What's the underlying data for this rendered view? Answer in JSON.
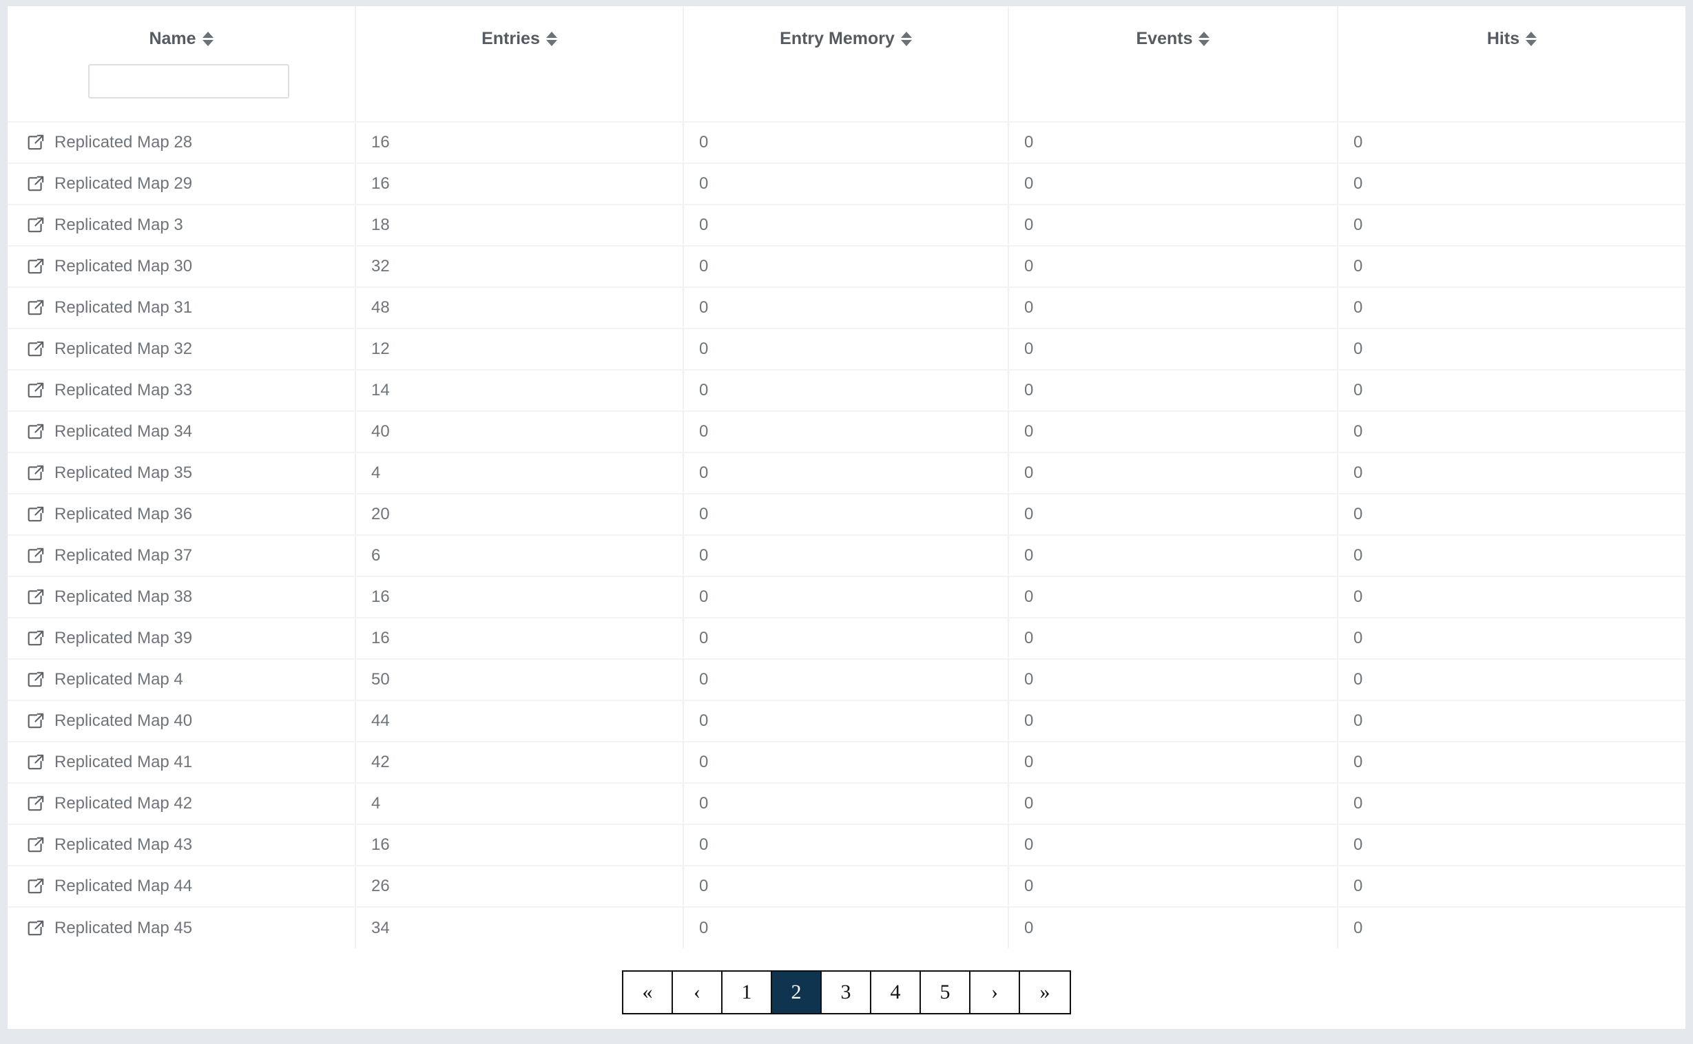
{
  "table": {
    "columns": [
      {
        "label": "Name",
        "sort_icon": "sort-both-icon",
        "key": "name"
      },
      {
        "label": "Entries",
        "sort_icon": "sort-both-icon",
        "key": "entries"
      },
      {
        "label": "Entry Memory",
        "sort_icon": "sort-both-icon",
        "key": "entry_memory"
      },
      {
        "label": "Events",
        "sort_icon": "sort-both-icon",
        "key": "events"
      },
      {
        "label": "Hits",
        "sort_icon": "sort-both-icon",
        "key": "hits"
      }
    ],
    "filter": {
      "value": "",
      "placeholder": ""
    },
    "row_icon": "external-link-icon",
    "rows": [
      {
        "name": "Replicated Map 28",
        "entries": "16",
        "entry_memory": "0",
        "events": "0",
        "hits": "0"
      },
      {
        "name": "Replicated Map 29",
        "entries": "16",
        "entry_memory": "0",
        "events": "0",
        "hits": "0"
      },
      {
        "name": "Replicated Map 3",
        "entries": "18",
        "entry_memory": "0",
        "events": "0",
        "hits": "0"
      },
      {
        "name": "Replicated Map 30",
        "entries": "32",
        "entry_memory": "0",
        "events": "0",
        "hits": "0"
      },
      {
        "name": "Replicated Map 31",
        "entries": "48",
        "entry_memory": "0",
        "events": "0",
        "hits": "0"
      },
      {
        "name": "Replicated Map 32",
        "entries": "12",
        "entry_memory": "0",
        "events": "0",
        "hits": "0"
      },
      {
        "name": "Replicated Map 33",
        "entries": "14",
        "entry_memory": "0",
        "events": "0",
        "hits": "0"
      },
      {
        "name": "Replicated Map 34",
        "entries": "40",
        "entry_memory": "0",
        "events": "0",
        "hits": "0"
      },
      {
        "name": "Replicated Map 35",
        "entries": "4",
        "entry_memory": "0",
        "events": "0",
        "hits": "0"
      },
      {
        "name": "Replicated Map 36",
        "entries": "20",
        "entry_memory": "0",
        "events": "0",
        "hits": "0"
      },
      {
        "name": "Replicated Map 37",
        "entries": "6",
        "entry_memory": "0",
        "events": "0",
        "hits": "0"
      },
      {
        "name": "Replicated Map 38",
        "entries": "16",
        "entry_memory": "0",
        "events": "0",
        "hits": "0"
      },
      {
        "name": "Replicated Map 39",
        "entries": "16",
        "entry_memory": "0",
        "events": "0",
        "hits": "0"
      },
      {
        "name": "Replicated Map 4",
        "entries": "50",
        "entry_memory": "0",
        "events": "0",
        "hits": "0"
      },
      {
        "name": "Replicated Map 40",
        "entries": "44",
        "entry_memory": "0",
        "events": "0",
        "hits": "0"
      },
      {
        "name": "Replicated Map 41",
        "entries": "42",
        "entry_memory": "0",
        "events": "0",
        "hits": "0"
      },
      {
        "name": "Replicated Map 42",
        "entries": "4",
        "entry_memory": "0",
        "events": "0",
        "hits": "0"
      },
      {
        "name": "Replicated Map 43",
        "entries": "16",
        "entry_memory": "0",
        "events": "0",
        "hits": "0"
      },
      {
        "name": "Replicated Map 44",
        "entries": "26",
        "entry_memory": "0",
        "events": "0",
        "hits": "0"
      },
      {
        "name": "Replicated Map 45",
        "entries": "34",
        "entry_memory": "0",
        "events": "0",
        "hits": "0"
      }
    ]
  },
  "pagination": {
    "items": [
      {
        "label": "«",
        "name": "first-page-button",
        "active": false
      },
      {
        "label": "‹",
        "name": "previous-page-button",
        "active": false
      },
      {
        "label": "1",
        "name": "page-1-button",
        "active": false
      },
      {
        "label": "2",
        "name": "page-2-button",
        "active": true
      },
      {
        "label": "3",
        "name": "page-3-button",
        "active": false
      },
      {
        "label": "4",
        "name": "page-4-button",
        "active": false
      },
      {
        "label": "5",
        "name": "page-5-button",
        "active": false
      },
      {
        "label": "›",
        "name": "next-page-button",
        "active": false
      },
      {
        "label": "»",
        "name": "last-page-button",
        "active": false
      }
    ],
    "current_page": "2"
  },
  "colors": {
    "page_background": "#e4e8ed",
    "card_background": "#ffffff",
    "active_page": "#0e3450",
    "header_text": "#555b61",
    "body_text": "#6e7479",
    "divider": "#f0f1f2"
  }
}
